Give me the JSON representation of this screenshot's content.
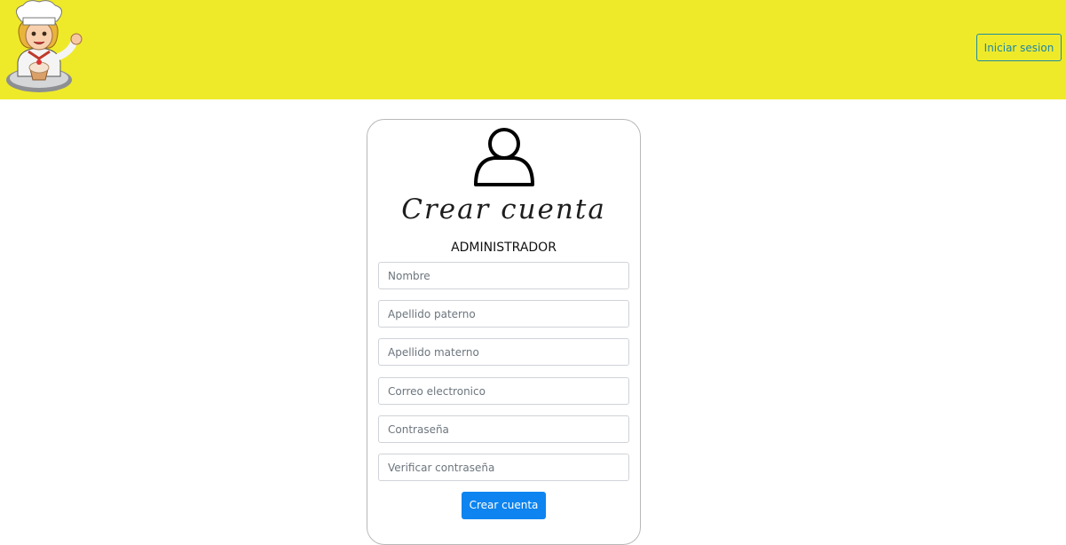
{
  "header": {
    "logo_icon": "chef-girl-logo-icon",
    "login_label": "Iniciar sesion",
    "background_color": "#eeea2a",
    "accent_color": "#1f86a8"
  },
  "form": {
    "user_icon": "user-icon",
    "title": "Crear cuenta",
    "subtitle": "ADMINISTRADOR",
    "fields": {
      "nombre": {
        "placeholder": "Nombre",
        "value": ""
      },
      "apellido_paterno": {
        "placeholder": "Apellido paterno",
        "value": ""
      },
      "apellido_materno": {
        "placeholder": "Apellido materno",
        "value": ""
      },
      "correo": {
        "placeholder": "Correo electronico",
        "value": ""
      },
      "contrasena": {
        "placeholder": "Contraseña",
        "value": ""
      },
      "verificar": {
        "placeholder": "Verificar contraseña",
        "value": ""
      }
    },
    "submit_label": "Crear cuenta",
    "submit_color": "#0d84f0"
  }
}
